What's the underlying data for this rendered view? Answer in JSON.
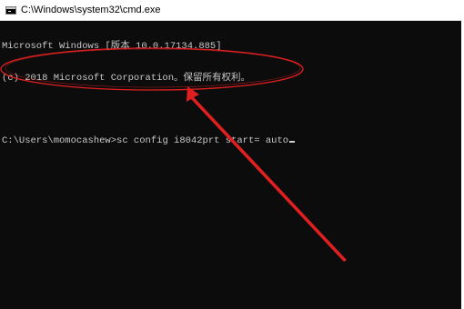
{
  "window": {
    "title": "C:\\Windows\\system32\\cmd.exe",
    "icon": "cmd-icon"
  },
  "console": {
    "lines": [
      "Microsoft Windows [版本 10.0.17134.885]",
      "(c) 2018 Microsoft Corporation。保留所有权利。"
    ],
    "prompt": "C:\\Users\\momocashew>",
    "command": "sc config i8042prt start= auto"
  },
  "colors": {
    "console_bg": "#0c0c0c",
    "console_text": "#c8c8c8",
    "annotation": "#e02020"
  }
}
